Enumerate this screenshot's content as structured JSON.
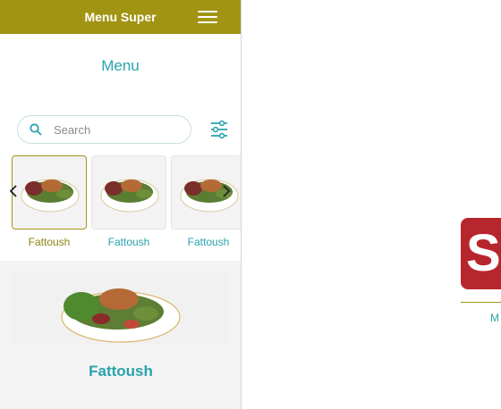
{
  "app": {
    "header_title": "Menu Super",
    "menu_heading": "Menu",
    "search": {
      "placeholder": "Search"
    },
    "categories": [
      {
        "label": "Fattoush",
        "active": true
      },
      {
        "label": "Fattoush",
        "active": false
      },
      {
        "label": "Fattoush",
        "active": false
      }
    ],
    "selected_item": {
      "name": "Fattoush"
    }
  },
  "colors": {
    "header": "#a29413",
    "accent_teal": "#2aa3ad",
    "logo_red": "#b8262d"
  },
  "icons": [
    "hamburger-icon",
    "search-icon",
    "filter-icon",
    "chevron-left-icon",
    "chevron-right-icon"
  ],
  "right_panel": {
    "logo_letter": "S",
    "subtext": "M"
  }
}
